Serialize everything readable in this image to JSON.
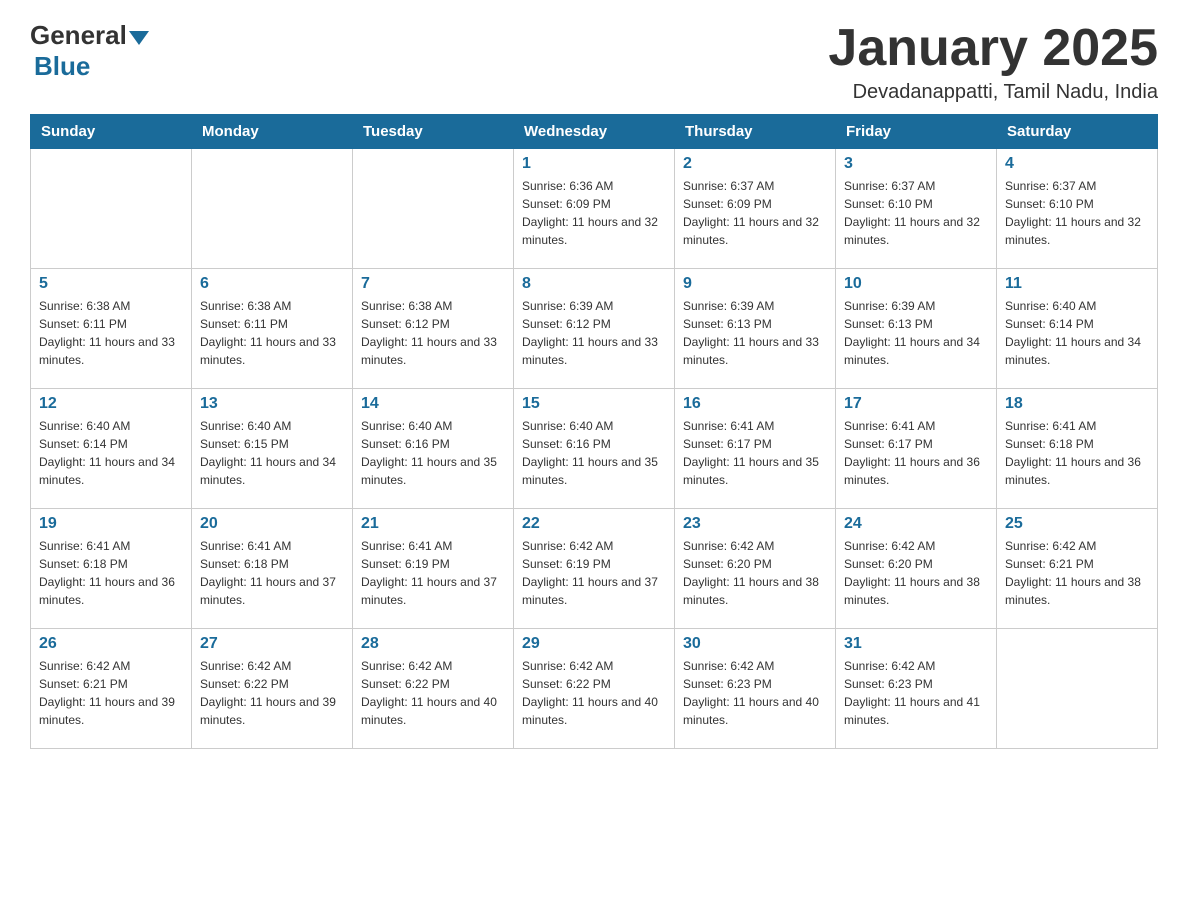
{
  "logo": {
    "text_general": "General",
    "text_blue": "Blue"
  },
  "title": "January 2025",
  "subtitle": "Devadanappatti, Tamil Nadu, India",
  "days_of_week": [
    "Sunday",
    "Monday",
    "Tuesday",
    "Wednesday",
    "Thursday",
    "Friday",
    "Saturday"
  ],
  "weeks": [
    [
      {
        "day": "",
        "info": ""
      },
      {
        "day": "",
        "info": ""
      },
      {
        "day": "",
        "info": ""
      },
      {
        "day": "1",
        "info": "Sunrise: 6:36 AM\nSunset: 6:09 PM\nDaylight: 11 hours and 32 minutes."
      },
      {
        "day": "2",
        "info": "Sunrise: 6:37 AM\nSunset: 6:09 PM\nDaylight: 11 hours and 32 minutes."
      },
      {
        "day": "3",
        "info": "Sunrise: 6:37 AM\nSunset: 6:10 PM\nDaylight: 11 hours and 32 minutes."
      },
      {
        "day": "4",
        "info": "Sunrise: 6:37 AM\nSunset: 6:10 PM\nDaylight: 11 hours and 32 minutes."
      }
    ],
    [
      {
        "day": "5",
        "info": "Sunrise: 6:38 AM\nSunset: 6:11 PM\nDaylight: 11 hours and 33 minutes."
      },
      {
        "day": "6",
        "info": "Sunrise: 6:38 AM\nSunset: 6:11 PM\nDaylight: 11 hours and 33 minutes."
      },
      {
        "day": "7",
        "info": "Sunrise: 6:38 AM\nSunset: 6:12 PM\nDaylight: 11 hours and 33 minutes."
      },
      {
        "day": "8",
        "info": "Sunrise: 6:39 AM\nSunset: 6:12 PM\nDaylight: 11 hours and 33 minutes."
      },
      {
        "day": "9",
        "info": "Sunrise: 6:39 AM\nSunset: 6:13 PM\nDaylight: 11 hours and 33 minutes."
      },
      {
        "day": "10",
        "info": "Sunrise: 6:39 AM\nSunset: 6:13 PM\nDaylight: 11 hours and 34 minutes."
      },
      {
        "day": "11",
        "info": "Sunrise: 6:40 AM\nSunset: 6:14 PM\nDaylight: 11 hours and 34 minutes."
      }
    ],
    [
      {
        "day": "12",
        "info": "Sunrise: 6:40 AM\nSunset: 6:14 PM\nDaylight: 11 hours and 34 minutes."
      },
      {
        "day": "13",
        "info": "Sunrise: 6:40 AM\nSunset: 6:15 PM\nDaylight: 11 hours and 34 minutes."
      },
      {
        "day": "14",
        "info": "Sunrise: 6:40 AM\nSunset: 6:16 PM\nDaylight: 11 hours and 35 minutes."
      },
      {
        "day": "15",
        "info": "Sunrise: 6:40 AM\nSunset: 6:16 PM\nDaylight: 11 hours and 35 minutes."
      },
      {
        "day": "16",
        "info": "Sunrise: 6:41 AM\nSunset: 6:17 PM\nDaylight: 11 hours and 35 minutes."
      },
      {
        "day": "17",
        "info": "Sunrise: 6:41 AM\nSunset: 6:17 PM\nDaylight: 11 hours and 36 minutes."
      },
      {
        "day": "18",
        "info": "Sunrise: 6:41 AM\nSunset: 6:18 PM\nDaylight: 11 hours and 36 minutes."
      }
    ],
    [
      {
        "day": "19",
        "info": "Sunrise: 6:41 AM\nSunset: 6:18 PM\nDaylight: 11 hours and 36 minutes."
      },
      {
        "day": "20",
        "info": "Sunrise: 6:41 AM\nSunset: 6:18 PM\nDaylight: 11 hours and 37 minutes."
      },
      {
        "day": "21",
        "info": "Sunrise: 6:41 AM\nSunset: 6:19 PM\nDaylight: 11 hours and 37 minutes."
      },
      {
        "day": "22",
        "info": "Sunrise: 6:42 AM\nSunset: 6:19 PM\nDaylight: 11 hours and 37 minutes."
      },
      {
        "day": "23",
        "info": "Sunrise: 6:42 AM\nSunset: 6:20 PM\nDaylight: 11 hours and 38 minutes."
      },
      {
        "day": "24",
        "info": "Sunrise: 6:42 AM\nSunset: 6:20 PM\nDaylight: 11 hours and 38 minutes."
      },
      {
        "day": "25",
        "info": "Sunrise: 6:42 AM\nSunset: 6:21 PM\nDaylight: 11 hours and 38 minutes."
      }
    ],
    [
      {
        "day": "26",
        "info": "Sunrise: 6:42 AM\nSunset: 6:21 PM\nDaylight: 11 hours and 39 minutes."
      },
      {
        "day": "27",
        "info": "Sunrise: 6:42 AM\nSunset: 6:22 PM\nDaylight: 11 hours and 39 minutes."
      },
      {
        "day": "28",
        "info": "Sunrise: 6:42 AM\nSunset: 6:22 PM\nDaylight: 11 hours and 40 minutes."
      },
      {
        "day": "29",
        "info": "Sunrise: 6:42 AM\nSunset: 6:22 PM\nDaylight: 11 hours and 40 minutes."
      },
      {
        "day": "30",
        "info": "Sunrise: 6:42 AM\nSunset: 6:23 PM\nDaylight: 11 hours and 40 minutes."
      },
      {
        "day": "31",
        "info": "Sunrise: 6:42 AM\nSunset: 6:23 PM\nDaylight: 11 hours and 41 minutes."
      },
      {
        "day": "",
        "info": ""
      }
    ]
  ]
}
